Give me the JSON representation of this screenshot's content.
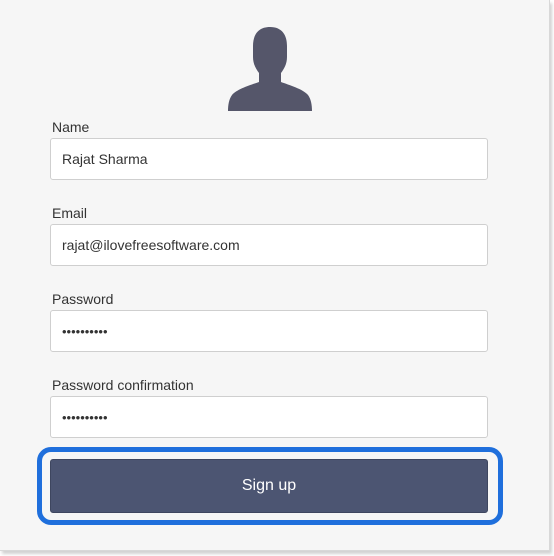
{
  "avatar_icon": "user-silhouette-icon",
  "colors": {
    "avatar": "#55566a",
    "button": "#4c5572",
    "focus_ring": "#1f6fdc",
    "background": "#f6f6f6"
  },
  "form": {
    "name": {
      "label": "Name",
      "value": "Rajat Sharma"
    },
    "email": {
      "label": "Email",
      "value": "rajat@ilovefreesoftware.com"
    },
    "password": {
      "label": "Password",
      "value": "••••••••••"
    },
    "password_confirmation": {
      "label": "Password confirmation",
      "value": "••••••••••"
    },
    "submit_label": "Sign up"
  }
}
